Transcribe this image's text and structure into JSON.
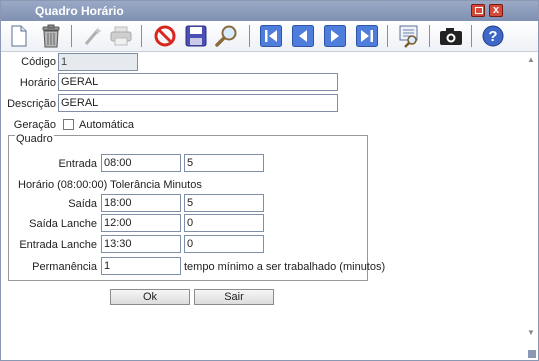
{
  "window": {
    "title": "Quadro Horário",
    "close_glyph": "x"
  },
  "toolbar": {
    "icons": [
      "new-document-icon",
      "delete-trash-icon",
      "edit-wand-icon",
      "print-icon",
      "cancel-icon",
      "save-icon",
      "search-icon",
      "first-record-icon",
      "previous-record-icon",
      "next-record-icon",
      "last-record-icon",
      "report-icon",
      "camera-icon",
      "help-icon"
    ],
    "colors": {
      "stop": "#d9261c",
      "save": "#4a4fb5",
      "nav": "#4f7ddb",
      "help": "#3d68c8"
    }
  },
  "form": {
    "codigo_label": "Código",
    "codigo_value": "1",
    "horario_label": "Horário",
    "horario_value": "GERAL",
    "descricao_label": "Descrição",
    "descricao_value": "GERAL",
    "geracao_label": "Geração",
    "automatica_label": "Automática"
  },
  "quadro": {
    "legend": "Quadro",
    "entrada_label": "Entrada",
    "entrada_value": "08:00",
    "entrada_tol": "5",
    "info_text": "Horário (08:00:00) Tolerância Minutos",
    "saida_label": "Saída",
    "saida_value": "18:00",
    "saida_tol": "5",
    "saida_lanche_label": "Saída Lanche",
    "saida_lanche_value": "12:00",
    "saida_lanche_tol": "0",
    "entrada_lanche_label": "Entrada Lanche",
    "entrada_lanche_value": "13:30",
    "entrada_lanche_tol": "0",
    "permanencia_label": "Permanência",
    "permanencia_value": "1",
    "permanencia_hint": "tempo mínimo a ser trabalhado (minutos)"
  },
  "buttons": {
    "ok": "Ok",
    "sair": "Sair"
  }
}
